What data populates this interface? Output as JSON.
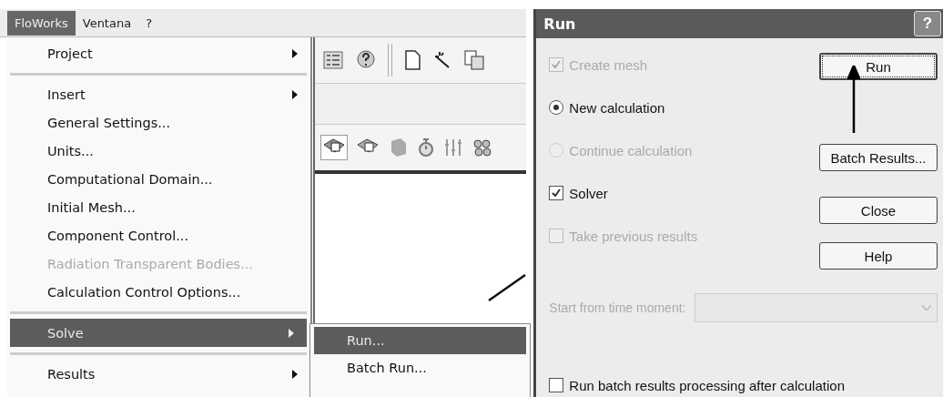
{
  "menubar": [
    {
      "label": "FloWorks",
      "selected": true
    },
    {
      "label": "Ventana",
      "selected": false
    },
    {
      "label": "?",
      "selected": false
    }
  ],
  "menu": {
    "items": [
      {
        "kind": "item",
        "label": "Project",
        "submenu": true,
        "disabled": false,
        "selected": false
      },
      {
        "kind": "separator"
      },
      {
        "kind": "item",
        "label": "Insert",
        "submenu": true,
        "disabled": false,
        "selected": false
      },
      {
        "kind": "item",
        "label": "General Settings...",
        "submenu": false,
        "disabled": false,
        "selected": false
      },
      {
        "kind": "item",
        "label": "Units...",
        "submenu": false,
        "disabled": false,
        "selected": false
      },
      {
        "kind": "item",
        "label": "Computational Domain...",
        "submenu": false,
        "disabled": false,
        "selected": false
      },
      {
        "kind": "item",
        "label": "Initial Mesh...",
        "submenu": false,
        "disabled": false,
        "selected": false
      },
      {
        "kind": "item",
        "label": "Component Control...",
        "submenu": false,
        "disabled": false,
        "selected": false
      },
      {
        "kind": "item",
        "label": "Radiation Transparent Bodies...",
        "submenu": false,
        "disabled": true,
        "selected": false
      },
      {
        "kind": "item",
        "label": "Calculation Control Options...",
        "submenu": false,
        "disabled": false,
        "selected": false
      },
      {
        "kind": "separator"
      },
      {
        "kind": "item",
        "label": "Solve",
        "submenu": true,
        "disabled": false,
        "selected": true
      },
      {
        "kind": "separator"
      },
      {
        "kind": "item",
        "label": "Results",
        "submenu": true,
        "disabled": false,
        "selected": false
      }
    ]
  },
  "submenu": {
    "items": [
      {
        "label": "Run...",
        "selected": true
      },
      {
        "label": "Batch Run...",
        "selected": false
      }
    ]
  },
  "dialog": {
    "title": "Run",
    "help_button": "?",
    "options": [
      {
        "kind": "checkbox",
        "label": "Create mesh",
        "checked": true,
        "disabled": true
      },
      {
        "kind": "radio",
        "label": "New calculation",
        "checked": true,
        "disabled": false
      },
      {
        "kind": "radio",
        "label": "Continue calculation",
        "checked": false,
        "disabled": true
      },
      {
        "kind": "checkbox",
        "label": "Solver",
        "checked": true,
        "disabled": false
      },
      {
        "kind": "checkbox",
        "label": "Take previous results",
        "checked": false,
        "disabled": true
      }
    ],
    "buttons": [
      {
        "label": "Run",
        "focused": true
      },
      {
        "label": "Batch Results...",
        "focused": false
      },
      {
        "label": "Close",
        "focused": false
      },
      {
        "label": "Help",
        "focused": false
      }
    ],
    "start_time": {
      "label": "Start from time moment:",
      "disabled": true
    },
    "batch_option": {
      "label": "Run batch results processing after calculation",
      "checked": false
    }
  }
}
